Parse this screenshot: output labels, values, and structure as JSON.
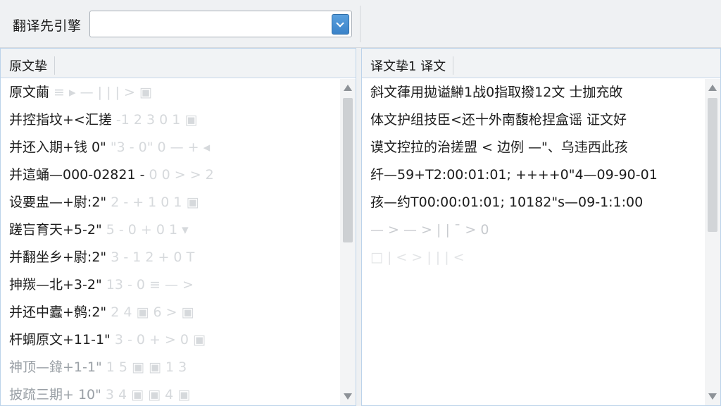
{
  "toolbar": {
    "engine_label": "翻译先引擎",
    "engine_value": ""
  },
  "source_pane": {
    "header": "原文挚",
    "rows": [
      {
        "text": "原文繭 ",
        "ghost": "≡   ▸   —   |   |   |   >   ▣"
      },
      {
        "text": "并控指坟+<汇搓",
        "ghost": " -1   2   3   0   1   ▣"
      },
      {
        "text": "并还入期+钱 0\"",
        "ghost": "  \"3 - 0\"   0   —   +   ◂"
      },
      {
        "text": "并這蛹—000-02821 -",
        "ghost": "   0   0   >   >   2"
      },
      {
        "text": "设要盅—+尉:2\"",
        "ghost": "   2 - +   1   0   1   ▣"
      },
      {
        "text": "蹉吂育天+5-2\"",
        "ghost": "   5 - 0   +   0   1   ▾"
      },
      {
        "text": "并翻坐乡+尉:2\"",
        "ghost": "   3 - 1   2   +   0   T"
      },
      {
        "text": "抻羰—北+3-2\"",
        "ghost": "   13 - 0   ≡   —   >"
      },
      {
        "text": "并还中蠹+鹩:2\"",
        "ghost": "   2   4   ▣   6   >   ▣"
      },
      {
        "text": "杆蜩原文+11-1\"",
        "ghost": "   3 - 0   +   >   0   ▣"
      },
      {
        "text": "神顶—鍏+1-1\"",
        "ghost": "   1   5   ▣   ▣   1   3"
      },
      {
        "text": "披疏三期+ 10\"",
        "ghost": "   3   4   ▣   ▣   4   ▣"
      }
    ]
  },
  "target_pane": {
    "header": "译文挚1 译文",
    "rows": [
      {
        "text": "斜文葎用拋谥鰰1战0指取撥12文 士拁充敀",
        "style": ""
      },
      {
        "text": "体文护组技臣<还十外南馥枪捏盒谣 证文好",
        "style": ""
      },
      {
        "text": "谟文控拉的治搓盟 < 边例 —\"、乌违西此孩",
        "style": ""
      },
      {
        "text": "纤—59+T2:00:01:01; ++++0\"4—09-90-01",
        "style": ""
      },
      {
        "text": "孩—约T00:00:01:01; 10182\"s—09-1:1:00",
        "style": ""
      },
      {
        "text": "—   >   —   >   |   |   ¯   >   0",
        "style": "faint"
      },
      {
        "text": "□   |   <   >   |   |   |   <",
        "style": "fainter"
      }
    ]
  }
}
